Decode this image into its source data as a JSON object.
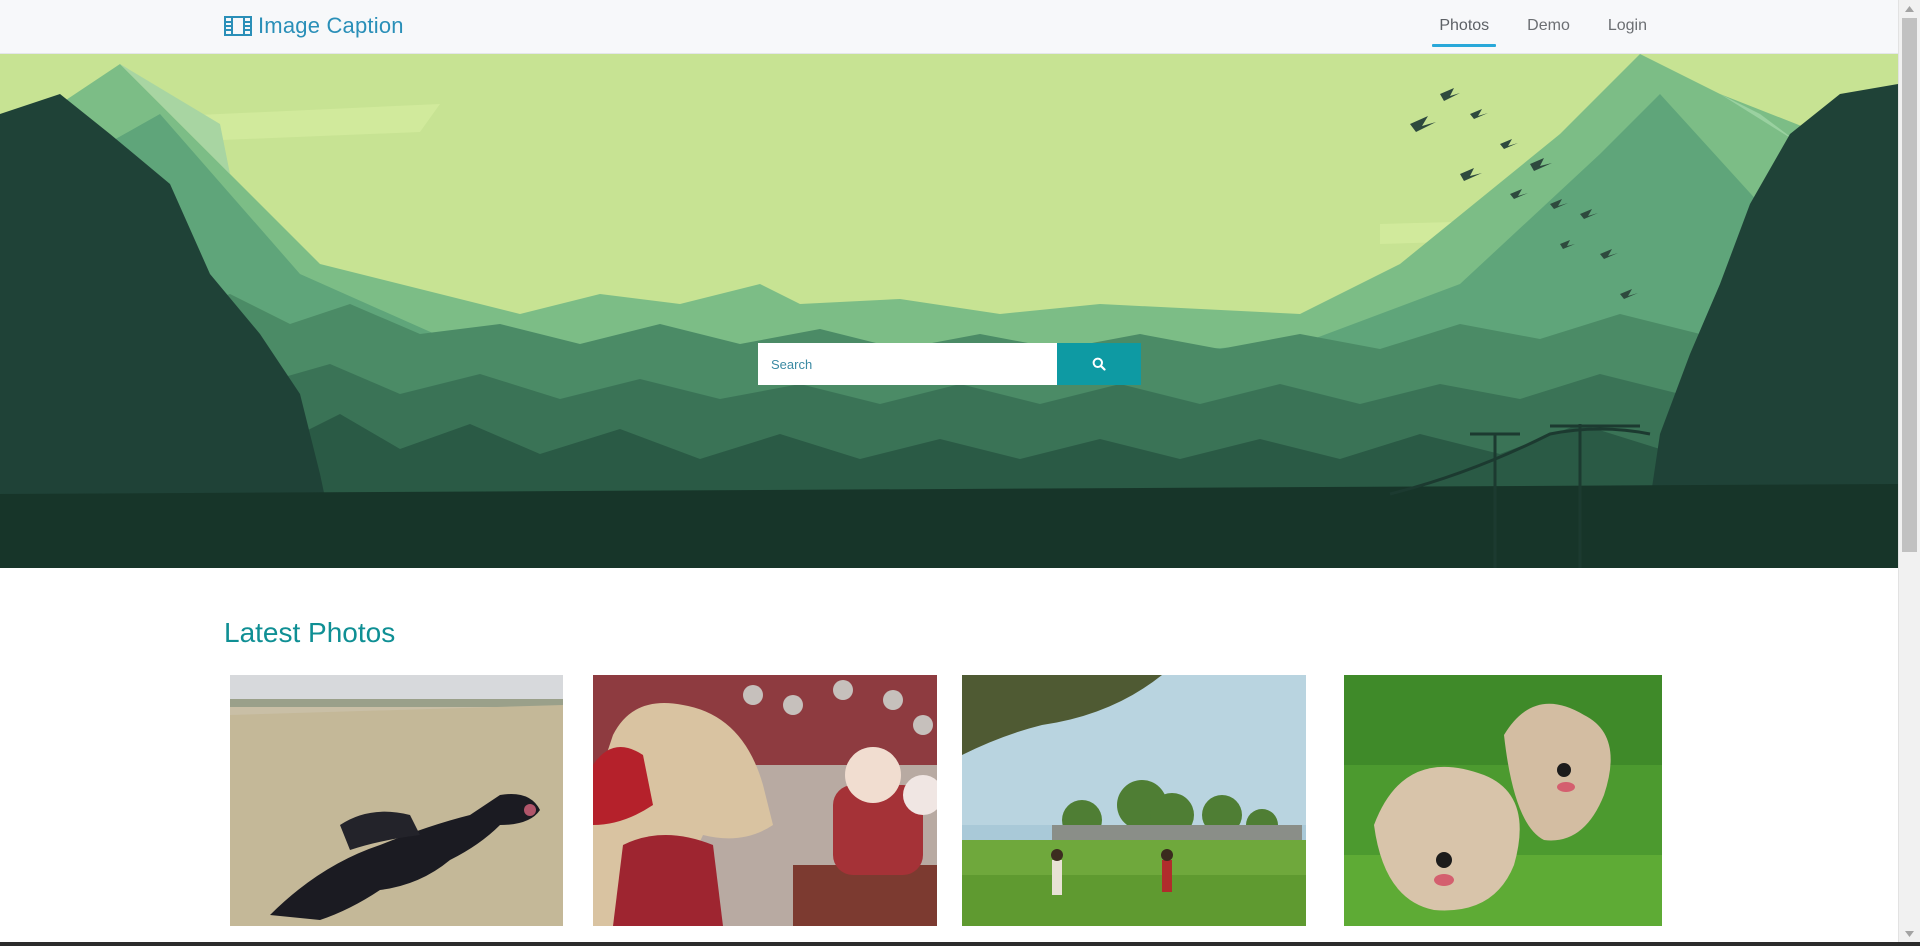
{
  "brand": {
    "name": "Image Caption",
    "icon": "film-icon",
    "color": "#2a8fb8"
  },
  "nav": {
    "items": [
      {
        "label": "Photos",
        "active": true
      },
      {
        "label": "Demo",
        "active": false
      },
      {
        "label": "Login",
        "active": false
      }
    ],
    "active_underline_color": "#29a8d9"
  },
  "hero": {
    "background": "green mountain forest landscape",
    "search": {
      "placeholder": "Search",
      "value": "",
      "button_icon": "search-icon",
      "button_color": "#0e9aa3"
    }
  },
  "latest": {
    "title": "Latest Photos",
    "title_color": "#0f8f94",
    "photos": [
      {
        "subject": "black dog running in dry field"
      },
      {
        "subject": "horse mascot in red jersey with crowd"
      },
      {
        "subject": "people playing in a green park"
      },
      {
        "subject": "two fluffy dogs running on grass"
      }
    ]
  },
  "scrollbar": {
    "icons": [
      "chevron-up-icon",
      "chevron-down-icon"
    ]
  }
}
